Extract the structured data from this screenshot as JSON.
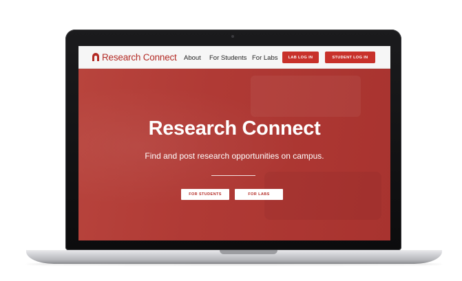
{
  "nav": {
    "logo_text": "Research Connect",
    "links": [
      "About",
      "For Students",
      "For Labs"
    ],
    "lab_login": "LAB LOG IN",
    "student_login": "STUDENT LOG IN"
  },
  "hero": {
    "title": "Research Connect",
    "subtitle": "Find and post research opportunities on campus.",
    "buttons": [
      "FOR STUDENTS",
      "FOR LABS"
    ]
  },
  "colors": {
    "brand_red": "#c8312a",
    "hero_red": "#b03a35",
    "nav_bg": "#f6f6f6"
  }
}
